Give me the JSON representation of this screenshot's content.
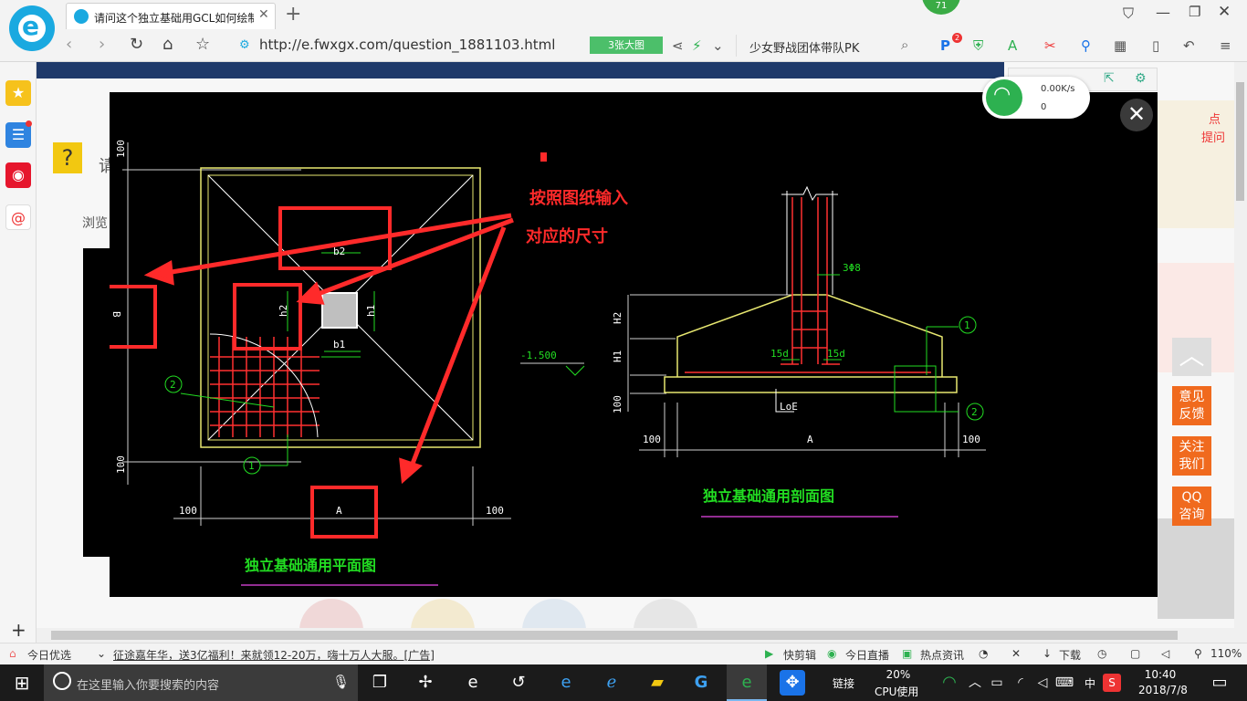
{
  "browser": {
    "tab_title": "请问这个独立基础用GCL如何绘制",
    "url": "http://e.fwxgx.com/question_1881103.html",
    "big_image_button": "3张大图",
    "search_hint": "少女野战团体带队PK",
    "badge_count": "71",
    "notif_count": "2"
  },
  "network": {
    "speed": "0.00K/s",
    "count": "0"
  },
  "drawing": {
    "annotation_line1": "按照图纸输入",
    "annotation_line2": "对应的尺寸",
    "plan_title": "独立基础通用平面图",
    "section_title": "独立基础通用剖面图",
    "dim_100": "100",
    "label_A": "A",
    "label_B": "B",
    "label_b1": "b1",
    "label_b2": "b2",
    "label_h1": "h1",
    "label_h2": "h2",
    "label_H1": "H1",
    "label_H2": "H2",
    "label_elev": "-1.500",
    "label_3phi8": "3Φ8",
    "label_15d": "15d",
    "label_LoE": "LoE",
    "marker_1": "1",
    "marker_2": "2"
  },
  "page": {
    "partial_text_1": "请",
    "partial_text_2": "浏览",
    "ad_text_1": "点",
    "ad_text_2": "提问"
  },
  "float_panel": {
    "feedback": "意见反馈",
    "follow": "关注我们",
    "qq": "QQ咨询"
  },
  "statusbar": {
    "today_pick": "今日优选",
    "ad_text": "征途嘉年华，送3亿福利！来就领12-20万，嗨十万人大服。[广告]",
    "quick_cut": "快剪辑",
    "live": "今日直播",
    "news": "热点资讯",
    "download": "下载",
    "zoom": "110%"
  },
  "taskbar": {
    "search_placeholder": "在这里输入你要搜索的内容",
    "link": "链接",
    "cpu_percent": "20%",
    "cpu_label": "CPU使用",
    "ime": "中",
    "time": "10:40",
    "date": "2018/7/8"
  },
  "colors": {
    "accent_blue": "#1aa9e0",
    "orange": "#f06a1e",
    "annotation_red": "#ff2a2a",
    "cad_green": "#22dd22",
    "cad_yellow": "#e8e870"
  }
}
